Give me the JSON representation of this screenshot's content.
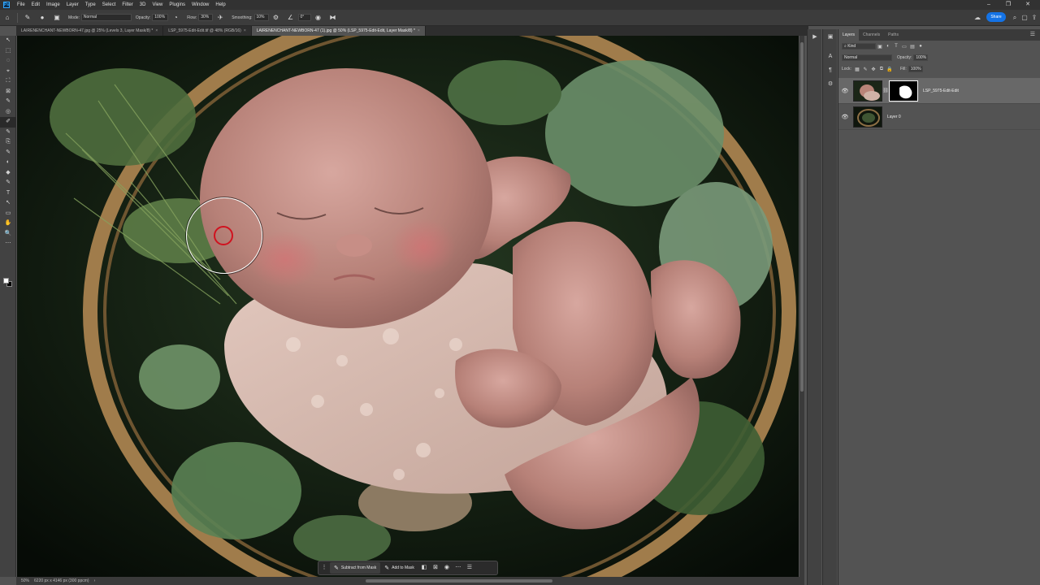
{
  "app": {
    "logo_text": "Ps"
  },
  "menubar": {
    "items": [
      "File",
      "Edit",
      "Image",
      "Layer",
      "Type",
      "Select",
      "Filter",
      "3D",
      "View",
      "Plugins",
      "Window",
      "Help"
    ]
  },
  "window_controls": {
    "minimize": "–",
    "maximize": "❐",
    "close": "✕"
  },
  "options_bar": {
    "mode_label": "Mode:",
    "mode_value": "Normal",
    "opacity_label": "Opacity:",
    "opacity_value": "100%",
    "flow_label": "Flow:",
    "flow_value": "30%",
    "smoothing_label": "Smoothing:",
    "smoothing_value": "10%",
    "angle_value": "0°",
    "share_label": "Share"
  },
  "tabs": [
    {
      "label": "LAIRENENCHANT-NEWBORN-47.jpg @ 25% (Levels 3, Layer Mask/8) *",
      "active": false
    },
    {
      "label": "LSP_5975-Edit-Edit.tif @ 48% (RGB/16)",
      "active": false
    },
    {
      "label": "LAIRENENCHANT-NEWBORN-47 (1).jpg @ 50% (LSP_5975-Edit-Edit, Layer Mask/8) *",
      "active": true
    }
  ],
  "tab_close_glyph": "×",
  "tools": [
    "↖",
    "⬚",
    "◌",
    "⌖",
    "⛶",
    "⊠",
    "✎",
    "◎",
    "✐",
    "✎",
    "⎘",
    "✎",
    "◐",
    "◆",
    "✎",
    "T",
    "↖",
    "▭",
    "✋",
    "🔍",
    "⋯"
  ],
  "taskbar": {
    "subtract_label": "Subtract from Mask",
    "add_label": "Add to Mask"
  },
  "statusbar": {
    "zoom": "50%",
    "doc_info": "6220 px x 4146 px (300 ppcm)",
    "arrow": "›"
  },
  "panel": {
    "tabs": [
      "Layers",
      "Channels",
      "Paths"
    ],
    "filter_value": "Kind",
    "blend_mode": "Normal",
    "opacity_label": "Opacity:",
    "opacity_value": "100%",
    "lock_label": "Lock:",
    "fill_label": "Fill:",
    "fill_value": "100%",
    "layers": [
      {
        "name": "LSP_5975-Edit-Edit",
        "selected": true,
        "has_mask": true
      },
      {
        "name": "Layer 0",
        "selected": false,
        "has_mask": false
      }
    ]
  },
  "colors": {
    "accent": "#1473e6",
    "brush_inner": "#d0121f",
    "panel_bg": "#535353"
  }
}
